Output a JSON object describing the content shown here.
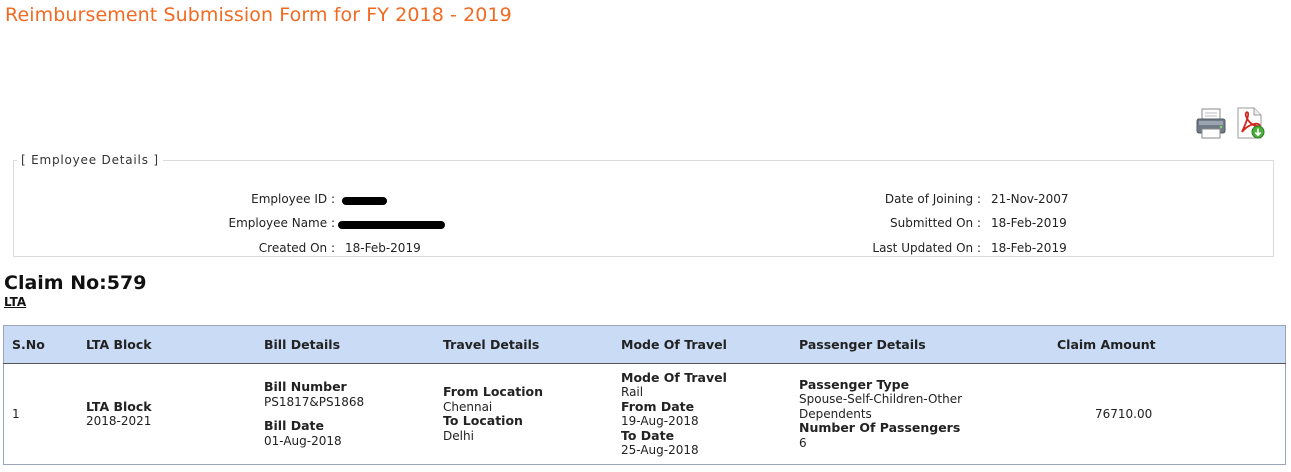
{
  "page": {
    "title": "Reimbursement Submission Form for FY 2018 - 2019"
  },
  "toolbar": {
    "print_icon": "printer-icon",
    "pdf_icon": "pdf-download-icon"
  },
  "employee": {
    "legend": "[ Employee Details ]",
    "id_label": "Employee ID :",
    "name_label": "Employee Name :",
    "created_label": "Created On :",
    "created_value": "18-Feb-2019",
    "doj_label": "Date of Joining :",
    "doj_value": "21-Nov-2007",
    "submitted_label": "Submitted On :",
    "submitted_value": "18-Feb-2019",
    "updated_label": "Last Updated On :",
    "updated_value": "18-Feb-2019"
  },
  "claim": {
    "number": "Claim No:579",
    "type": "LTA"
  },
  "table": {
    "headers": [
      "S.No",
      "LTA Block",
      "Bill Details",
      "Travel Details",
      "Mode Of Travel",
      "Passenger Details",
      "Claim Amount"
    ],
    "row": {
      "sno": "1",
      "block_label": "LTA Block",
      "block_value": "2018-2021",
      "bill_number_label": "Bill Number",
      "bill_number_value": "PS1817&PS1868",
      "bill_date_label": "Bill Date",
      "bill_date_value": "01-Aug-2018",
      "from_label": "From Location",
      "from_value": "Chennai",
      "to_label": "To Location",
      "to_value": "Delhi",
      "mode_label": "Mode Of Travel",
      "mode_value": "Rail",
      "from_date_label": "From Date",
      "from_date_value": "19-Aug-2018",
      "to_date_label": "To Date",
      "to_date_value": "25-Aug-2018",
      "ptype_label": "Passenger Type",
      "ptype_value": "Spouse-Self-Children-Other Dependents",
      "pcount_label": "Number Of Passengers",
      "pcount_value": "6",
      "amount": "76710.00"
    }
  }
}
